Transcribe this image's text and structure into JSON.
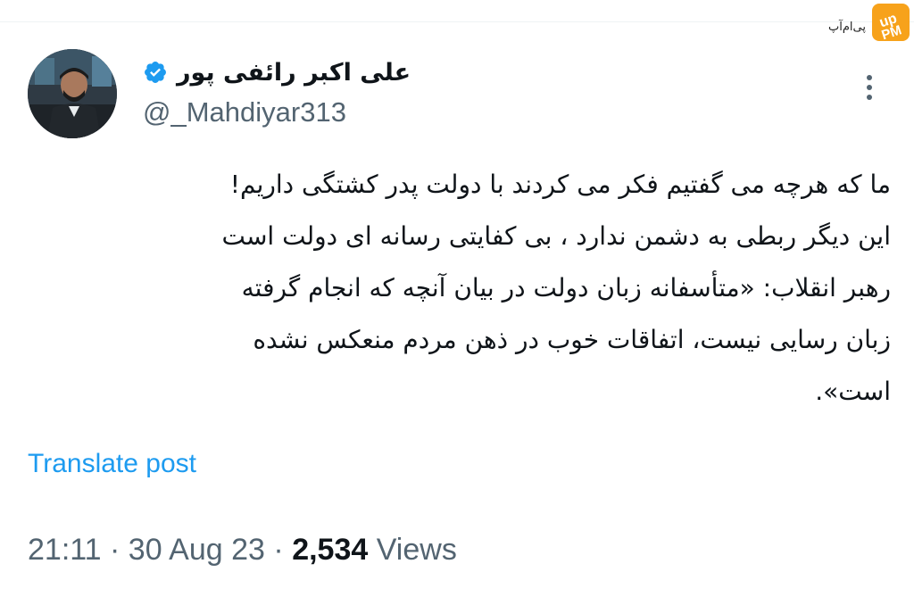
{
  "watermark": {
    "text": "پی‌ام‌آپ",
    "logo_icon": "pmup-logo-icon",
    "logo_color": "#f7a21b"
  },
  "author": {
    "display_name": "علی اکبر رائفی پور",
    "handle": "@_Mahdiyar313",
    "verified": true,
    "verified_color": "#1d9bf0",
    "avatar_icon": "profile-photo"
  },
  "tweet": {
    "lines": [
      "ما که هرچه می گفتیم فکر می کردند با دولت پدر کشتگی داریم!",
      "این دیگر ربطی به دشمن ندارد ، بی کفایتی رسانه ای دولت است",
      "رهبر انقلاب: «متأسفانه زبان دولت در بیان آنچه که انجام گرفته",
      "زبان رسایی نیست، اتفاقات خوب در ذهن مردم منعکس نشده",
      "است»."
    ]
  },
  "actions": {
    "translate_label": "Translate post",
    "more_icon": "more-vertical-icon"
  },
  "meta": {
    "time": "21:11",
    "separator": "·",
    "date": "30 Aug 23",
    "views_count": "2,534",
    "views_label": "Views"
  },
  "colors": {
    "text_primary": "#0f1419",
    "text_secondary": "#536471",
    "link": "#1d9bf0"
  }
}
